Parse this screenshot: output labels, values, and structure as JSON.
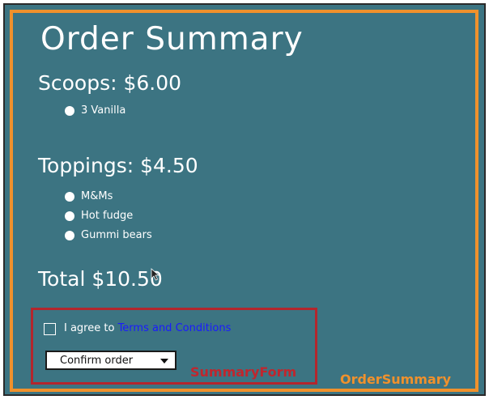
{
  "title": "Order Summary",
  "scoops": {
    "heading": "Scoops: $6.00",
    "items": [
      "3 Vanilla"
    ]
  },
  "toppings": {
    "heading": "Toppings: $4.50",
    "items": [
      "M&Ms",
      "Hot fudge",
      "Gummi bears"
    ]
  },
  "total": "Total $10.50",
  "form": {
    "agree_text": "I agree to ",
    "terms_link": "Terms and Conditions",
    "checkbox_checked": false,
    "confirm_button": "Confirm order",
    "label": "SummaryForm"
  },
  "component_label": "OrderSummary",
  "colors": {
    "panel_background": "#3c7482",
    "order_summary_frame": "#f0912c",
    "summary_form_frame": "#b3262d",
    "link": "#1a1aff"
  },
  "icons": {
    "bullet": "filled-circle",
    "dropdown": "chevron-down-icon",
    "cursor": "mouse-pointer-icon"
  }
}
